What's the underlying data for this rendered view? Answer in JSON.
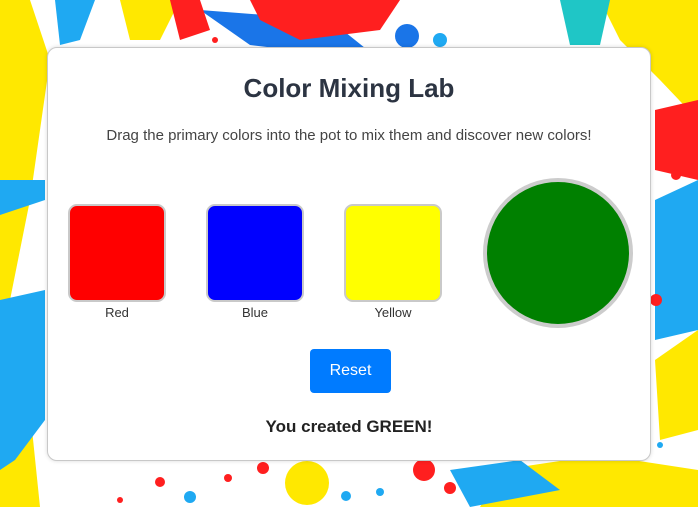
{
  "app": {
    "title": "Color Mixing Lab",
    "instructions": "Drag the primary colors into the pot to mix them and discover new colors!"
  },
  "colors": [
    {
      "label": "Red",
      "hex": "#ff0000"
    },
    {
      "label": "Blue",
      "hex": "#0000ff"
    },
    {
      "label": "Yellow",
      "hex": "#ffff00"
    }
  ],
  "pot": {
    "color": "#008000"
  },
  "reset_button": {
    "label": "Reset",
    "color": "#007bff"
  },
  "result": {
    "text": "You created GREEN!"
  },
  "background": {
    "palette": [
      "#ff1f1f",
      "#1fa9f2",
      "#ffe800",
      "#1fc6c6",
      "#1a75e8"
    ]
  }
}
